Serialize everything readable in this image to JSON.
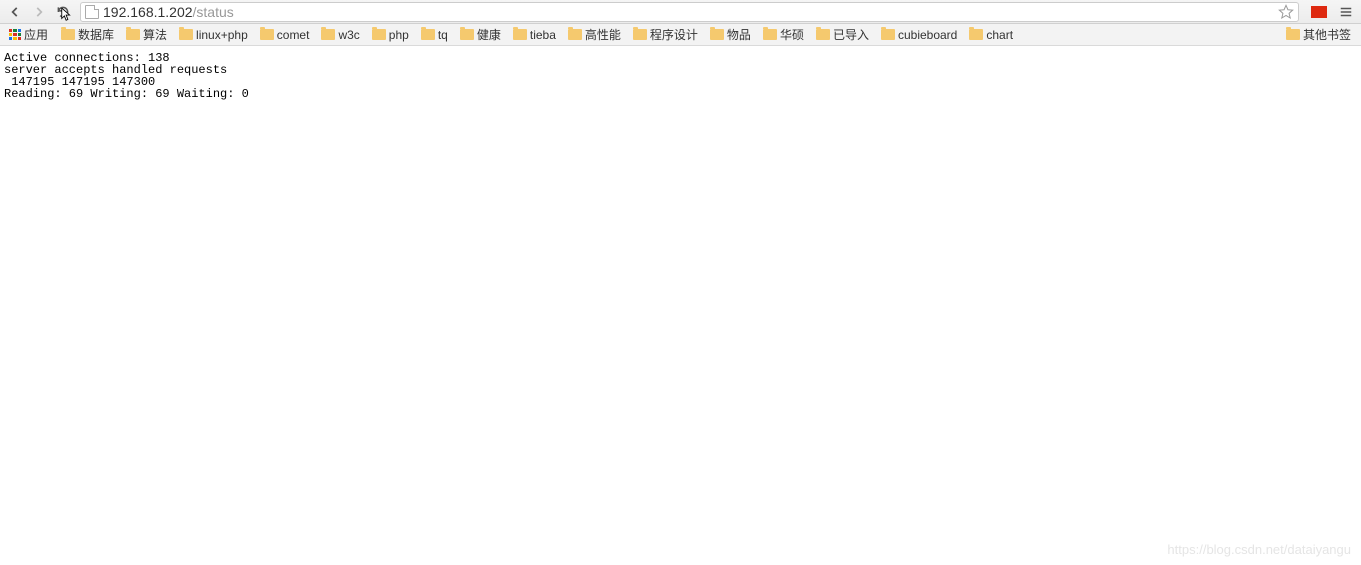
{
  "toolbar": {
    "url_main": "192.168.1.202",
    "url_path": "/status"
  },
  "bookmarks": {
    "apps_label": "应用",
    "items": [
      "数据库",
      "算法",
      "linux+php",
      "comet",
      "w3c",
      "php",
      "tq",
      "健康",
      "tieba",
      "高性能",
      "程序设计",
      "物品",
      "华硕",
      "已导入",
      "cubieboard",
      "chart"
    ],
    "other_label": "其他书签"
  },
  "status": {
    "line1": "Active connections: 138 ",
    "line2": "server accepts handled requests",
    "line3": " 147195 147195 147300 ",
    "line4": "Reading: 69 Writing: 69 Waiting: 0 "
  },
  "watermark": "https://blog.csdn.net/dataiyangu"
}
